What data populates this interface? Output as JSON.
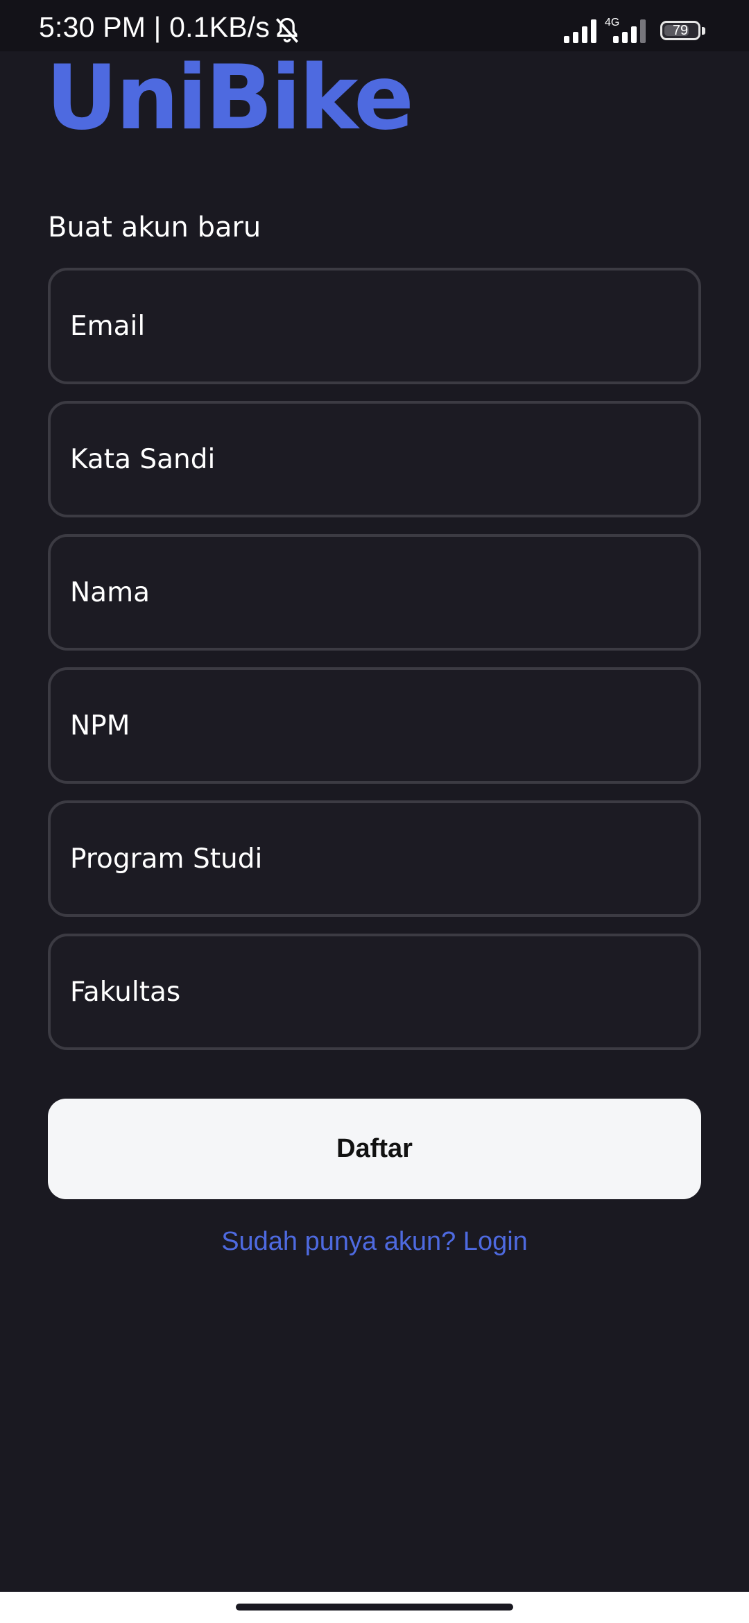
{
  "status_bar": {
    "time_speed": "5:30 PM | 0.1KB/s",
    "network_type": "4G",
    "battery_level": "79"
  },
  "app": {
    "logo": "UniBike"
  },
  "form": {
    "heading": "Buat akun baru",
    "fields": [
      {
        "placeholder": "Email",
        "value": ""
      },
      {
        "placeholder": "Kata Sandi",
        "value": ""
      },
      {
        "placeholder": "Nama",
        "value": ""
      },
      {
        "placeholder": "NPM",
        "value": ""
      },
      {
        "placeholder": "Program Studi",
        "value": ""
      },
      {
        "placeholder": "Fakultas",
        "value": ""
      }
    ],
    "submit_label": "Daftar",
    "login_link": "Sudah punya akun? Login"
  },
  "colors": {
    "background": "#1a1921",
    "accent": "#4e6ae0",
    "field_border": "#3c3b43",
    "button_bg": "#f5f6f8"
  },
  "icons": [
    "bell-off-icon",
    "signal-icon",
    "battery-icon"
  ]
}
